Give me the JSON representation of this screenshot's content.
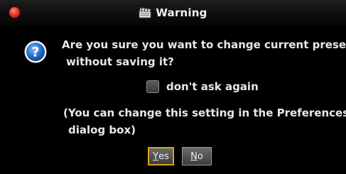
{
  "window": {
    "title": "Warning"
  },
  "message": {
    "line1": "Are you sure you want to change current preset",
    "line2": "without saving it?"
  },
  "checkbox": {
    "label": "don't ask again",
    "checked": false
  },
  "note": {
    "line1": "(You can change this setting in the Preferences",
    "line2": "dialog box)"
  },
  "buttons": {
    "yes": {
      "mnemonic": "Y",
      "rest": "es"
    },
    "no": {
      "mnemonic": "N",
      "rest": "o"
    }
  },
  "icons": {
    "close": "close-icon",
    "title": "film-clapper-icon",
    "message": "question-icon"
  },
  "colors": {
    "focus_ring": "#d9a21c",
    "question_blue": "#2a6fd0",
    "close_red": "#e0392c"
  }
}
